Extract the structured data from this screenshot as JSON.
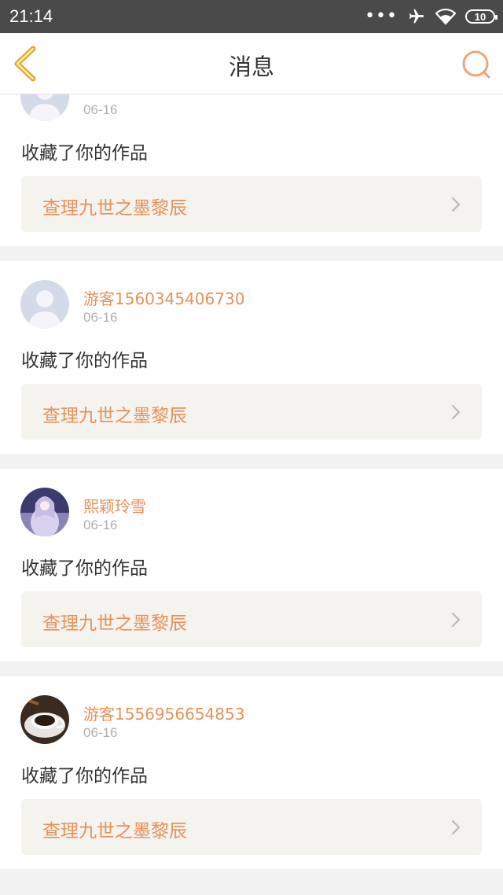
{
  "status_bar": {
    "time": "21:14",
    "dots": "•••",
    "battery": "10"
  },
  "nav": {
    "title": "消息"
  },
  "messages": [
    {
      "user": "",
      "date": "06-16",
      "action": "收藏了你的作品",
      "work": "查理九世之墨黎辰",
      "avatar": "default-avatar"
    },
    {
      "user": "游客1560345406730",
      "date": "06-16",
      "action": "收藏了你的作品",
      "work": "查理九世之墨黎辰",
      "avatar": "default-avatar"
    },
    {
      "user": "熙颖玲雪",
      "date": "06-16",
      "action": "收藏了你的作品",
      "work": "查理九世之墨黎辰",
      "avatar": "anime-avatar"
    },
    {
      "user": "游客1556956654853",
      "date": "06-16",
      "action": "收藏了你的作品",
      "work": "查理九世之墨黎辰",
      "avatar": "coffee-avatar"
    }
  ],
  "colors": {
    "accent": "#e8915a",
    "back_icon": "#e8a92a"
  }
}
